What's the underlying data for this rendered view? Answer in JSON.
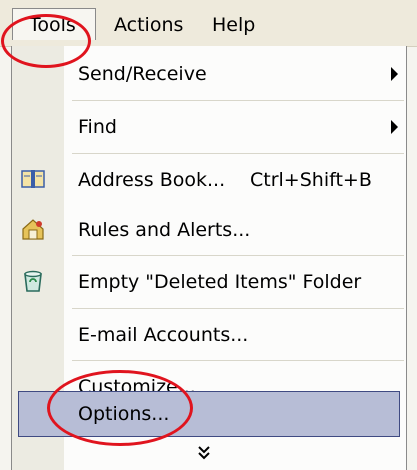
{
  "menubar": {
    "tools": "Tools",
    "actions": "Actions",
    "help": "Help"
  },
  "menu": {
    "items": [
      {
        "label": "Send/Receive",
        "has_submenu": true
      },
      {
        "label": "Find",
        "has_submenu": true
      },
      {
        "label": "Address Book...",
        "shortcut": "Ctrl+Shift+B",
        "icon": "address-book-icon"
      },
      {
        "label": "Rules and Alerts...",
        "icon": "rules-alerts-icon"
      },
      {
        "label": "Empty \"Deleted Items\" Folder",
        "icon": "deleted-items-icon"
      },
      {
        "label": "E-mail Accounts..."
      },
      {
        "label": "Customize..."
      },
      {
        "label": "Options...",
        "highlighted": true
      }
    ],
    "expand_icon": "chevron-double-down-icon"
  },
  "colors": {
    "highlight": "#b7bdd6",
    "annotation": "#e0141e"
  }
}
